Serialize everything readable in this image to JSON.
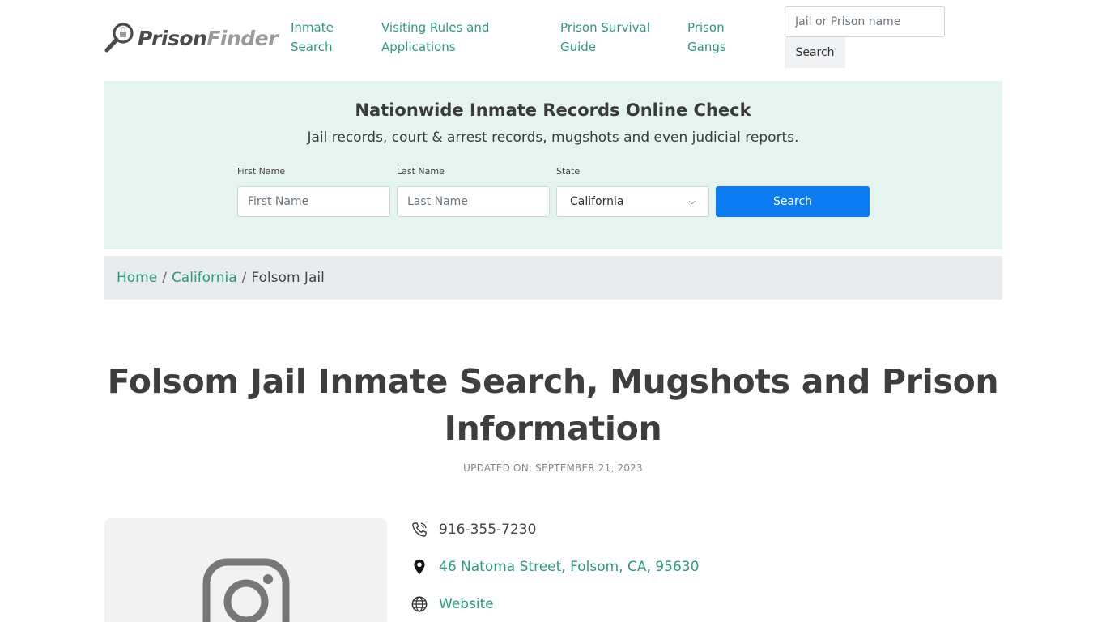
{
  "header": {
    "logo": {
      "part1": "Prison",
      "part2": "Finder"
    },
    "nav": [
      {
        "line1": "Inmate",
        "line2": "Search"
      },
      {
        "line1": "Visiting Rules and",
        "line2": "Applications"
      },
      {
        "line1": "Prison Survival",
        "line2": "Guide"
      },
      {
        "line1": "Prison",
        "line2": "Gangs"
      }
    ],
    "search": {
      "placeholder": "Jail or Prison name",
      "button_label": "Search"
    }
  },
  "hero": {
    "title": "Nationwide Inmate Records Online Check",
    "subtitle": "Jail records, court & arrest records, mugshots and even judicial reports.",
    "first_name": {
      "label": "First Name",
      "placeholder": "First Name"
    },
    "last_name": {
      "label": "Last Name",
      "placeholder": "Last Name"
    },
    "state": {
      "label": "State",
      "value": "California"
    },
    "button_label": "Search",
    "bg_color": "#e6f4f0",
    "button_color": "#0d7cf2"
  },
  "breadcrumb": {
    "items": [
      "Home",
      "California",
      "Folsom Jail"
    ],
    "separator": "/"
  },
  "page": {
    "title_line1": "Folsom Jail Inmate Search, Mugshots and Prison",
    "title_line2": "Information",
    "updated": "UPDATED ON: SEPTEMBER 21, 2023"
  },
  "info": {
    "phone": "916-355-7230",
    "address": "46 Natoma Street, Folsom, CA, 95630",
    "website_label": "Website",
    "icons": [
      "phone-icon",
      "map-pin-icon",
      "globe-icon"
    ]
  },
  "colors": {
    "link": "#2a9d74",
    "accent_blue": "#0d7cf2"
  }
}
